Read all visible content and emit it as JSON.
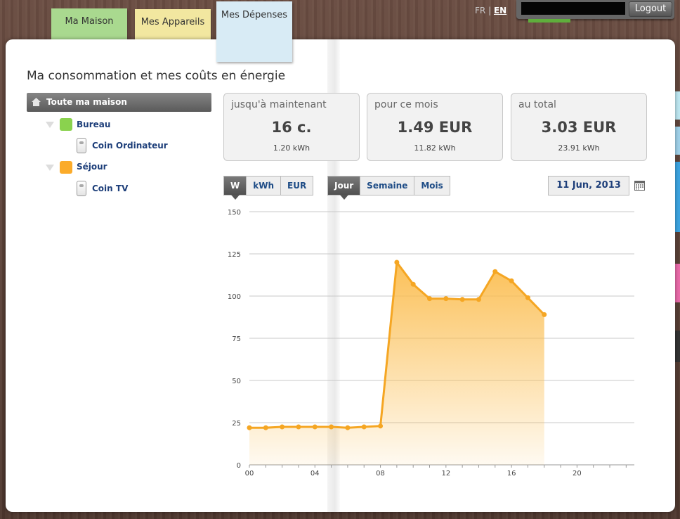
{
  "nav": {
    "tabs": [
      {
        "label": "Ma Maison",
        "color": "#a9d98f"
      },
      {
        "label": "Mes Appareils",
        "color": "#f2e7a0"
      },
      {
        "label": "Mes Dépenses",
        "color": "#d8ebf5"
      }
    ],
    "lang_fr": "FR",
    "lang_sep": "|",
    "lang_en": "EN",
    "logout_label": "Logout"
  },
  "page_title": "Ma consommation et mes coûts en énergie",
  "tree": {
    "root_label": "Toute ma maison",
    "groups": [
      {
        "label": "Bureau",
        "color": "#8ad24e",
        "device": "Coin Ordinateur"
      },
      {
        "label": "Séjour",
        "color": "#fbab2a",
        "device": "Coin TV"
      }
    ]
  },
  "stats": [
    {
      "label": "jusqu'à maintenant",
      "value": "16 c.",
      "sub": "1.20 kWh"
    },
    {
      "label": "pour ce mois",
      "value": "1.49 EUR",
      "sub": "11.82 kWh"
    },
    {
      "label": "au total",
      "value": "3.03 EUR",
      "sub": "23.91 kWh"
    }
  ],
  "unit_buttons": [
    "W",
    "kWh",
    "EUR"
  ],
  "unit_selected": "W",
  "period_buttons": [
    "Jour",
    "Semaine",
    "Mois"
  ],
  "period_selected": "Jour",
  "date_label": "11 Jun, 2013",
  "calendar_icon": "calendar-icon",
  "chart_data": {
    "type": "area",
    "x_tick_labels": [
      "00",
      "04",
      "08",
      "12",
      "16",
      "20"
    ],
    "y_tick_labels": [
      "0",
      "25",
      "50",
      "75",
      "100",
      "125",
      "150"
    ],
    "ylim": [
      0,
      150
    ],
    "xlim": [
      0,
      23.5
    ],
    "color": "#f5a623",
    "fill_color": "#fbbd4f",
    "grid": true,
    "x": [
      0,
      1,
      2,
      3,
      4,
      5,
      6,
      7,
      8,
      9,
      10,
      11,
      12,
      13,
      14,
      15,
      16,
      17,
      18
    ],
    "values": [
      22,
      22,
      22.5,
      22.5,
      22.5,
      22.5,
      22,
      22.5,
      23,
      120,
      107,
      98.5,
      98.5,
      98,
      98,
      114.5,
      109,
      99,
      89
    ]
  }
}
